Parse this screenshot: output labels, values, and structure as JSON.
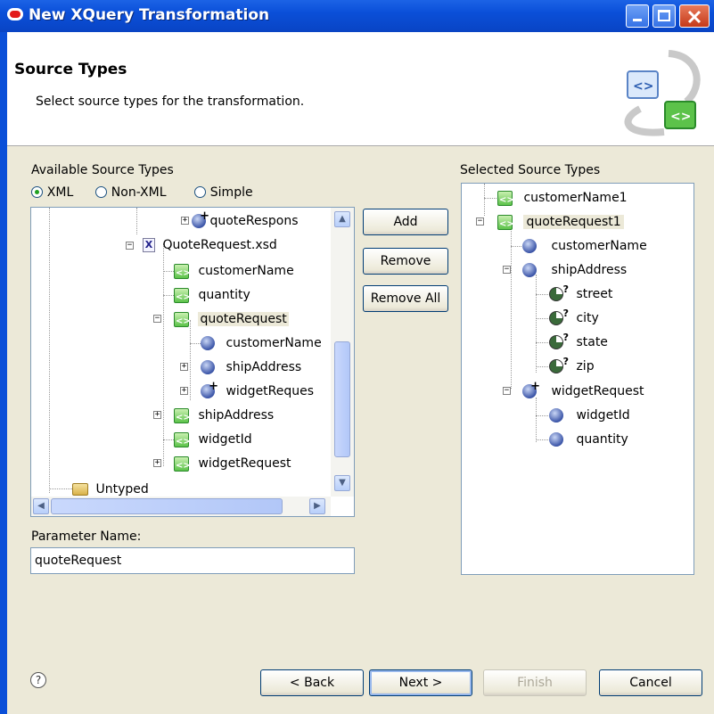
{
  "window": {
    "title": "New XQuery Transformation"
  },
  "header": {
    "title": "Source Types",
    "description": "Select source types for the transformation."
  },
  "available": {
    "label": "Available Source Types",
    "radios": [
      {
        "label": "XML",
        "selected": true
      },
      {
        "label": "Non-XML",
        "selected": false
      },
      {
        "label": "Simple",
        "selected": false
      }
    ],
    "tree": [
      {
        "label": "quoteRespons",
        "icon": "element-plus-icon"
      },
      {
        "label": "QuoteRequest.xsd",
        "icon": "xsd-file-icon"
      },
      {
        "label": "customerName",
        "icon": "element-icon"
      },
      {
        "label": "quantity",
        "icon": "element-icon"
      },
      {
        "label": "quoteRequest",
        "icon": "element-icon"
      },
      {
        "label": "customerName",
        "icon": "ball-icon"
      },
      {
        "label": "shipAddress",
        "icon": "ball-icon"
      },
      {
        "label": "widgetReques",
        "icon": "ball-plus-icon"
      },
      {
        "label": "shipAddress",
        "icon": "element-icon"
      },
      {
        "label": "widgetId",
        "icon": "element-icon"
      },
      {
        "label": "widgetRequest",
        "icon": "element-icon"
      },
      {
        "label": "Untyped",
        "icon": "folder-icon"
      }
    ]
  },
  "buttons": {
    "add": "Add",
    "remove": "Remove",
    "remove_all": "Remove All"
  },
  "parameter": {
    "label": "Parameter Name:",
    "value": "quoteRequest"
  },
  "selected": {
    "label": "Selected Source Types",
    "tree": [
      {
        "label": "customerName1",
        "icon": "element-icon"
      },
      {
        "label": "quoteRequest1",
        "icon": "element-icon"
      },
      {
        "label": "customerName",
        "icon": "ball-icon"
      },
      {
        "label": "shipAddress",
        "icon": "ball-icon"
      },
      {
        "label": "street",
        "icon": "pie-icon"
      },
      {
        "label": "city",
        "icon": "pie-icon"
      },
      {
        "label": "state",
        "icon": "pie-icon"
      },
      {
        "label": "zip",
        "icon": "pie-icon"
      },
      {
        "label": "widgetRequest",
        "icon": "ball-plus-icon"
      },
      {
        "label": "widgetId",
        "icon": "ball-icon"
      },
      {
        "label": "quantity",
        "icon": "ball-icon"
      }
    ]
  },
  "footer": {
    "help_icon": "?",
    "back": "< Back",
    "next": "Next >",
    "finish": "Finish",
    "cancel": "Cancel"
  }
}
